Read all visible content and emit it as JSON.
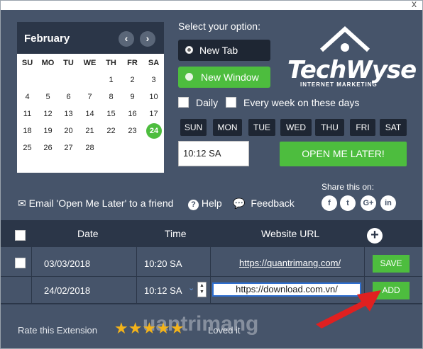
{
  "window": {
    "close_glyph": "x"
  },
  "calendar": {
    "month": "February",
    "prev_glyph": "‹",
    "next_glyph": "›",
    "dow": [
      "SU",
      "MO",
      "TU",
      "WE",
      "TH",
      "FR",
      "SA"
    ],
    "weeks": [
      [
        "",
        "",
        "",
        "",
        "1",
        "2",
        "3"
      ],
      [
        "4",
        "5",
        "6",
        "7",
        "8",
        "9",
        "10"
      ],
      [
        "11",
        "12",
        "13",
        "14",
        "15",
        "16",
        "17"
      ],
      [
        "18",
        "19",
        "20",
        "21",
        "22",
        "23",
        "24"
      ],
      [
        "25",
        "26",
        "27",
        "28",
        "",
        "",
        ""
      ]
    ],
    "selected_day": "24"
  },
  "options": {
    "title": "Select your option:",
    "new_tab": "New Tab",
    "new_window": "New Window",
    "daily": "Daily",
    "every_week": "Every week on these days",
    "days": [
      "SUN",
      "MON",
      "TUE",
      "WED",
      "THU",
      "FRI",
      "SAT"
    ],
    "time_value": "10:12 SA",
    "open_later": "OPEN ME LATER!"
  },
  "logo": {
    "word": "TechWyse",
    "sub": "INTERNET MARKETING"
  },
  "links": {
    "email": "Email 'Open Me Later' to a friend",
    "help": "Help",
    "feedback": "Feedback",
    "share": "Share this on:",
    "social": [
      {
        "name": "facebook-icon",
        "glyph": "f"
      },
      {
        "name": "twitter-icon",
        "glyph": "t"
      },
      {
        "name": "google-plus-icon",
        "glyph": "G+"
      },
      {
        "name": "linkedin-icon",
        "glyph": "in"
      }
    ]
  },
  "table": {
    "headers": {
      "date": "Date",
      "time": "Time",
      "url": "Website URL"
    },
    "rows": [
      {
        "date": "03/03/2018",
        "time": "10:20 SA",
        "url": "https://quantrimang.com/",
        "action": "SAVE"
      },
      {
        "date": "24/02/2018",
        "time": "10:12 SA",
        "url": "https://download.com.vn/",
        "action": "ADD"
      }
    ]
  },
  "footer": {
    "rate": "Rate this Extension",
    "stars": "★★★★★",
    "loved": "Loved it",
    "watermark": "uantrimang"
  },
  "colors": {
    "bg": "#46546a",
    "dark": "#2b3648",
    "green": "#4dbd3e",
    "arrow": "#e02020"
  }
}
